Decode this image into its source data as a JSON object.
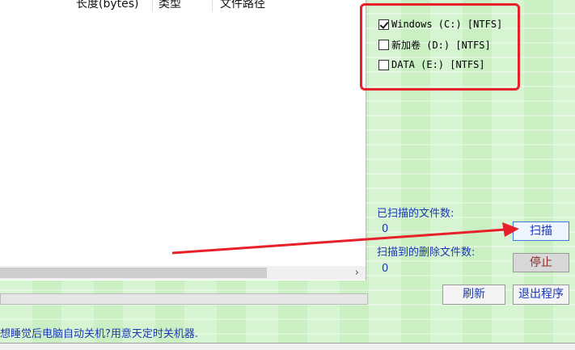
{
  "list": {
    "columns": [
      "长度(bytes)",
      "类型",
      "文件路径"
    ]
  },
  "drives": [
    {
      "label": "Windows (C:) [NTFS]",
      "checked": true
    },
    {
      "label": "新加卷 (D:) [NTFS]",
      "checked": false
    },
    {
      "label": "DATA (E:) [NTFS]",
      "checked": false
    }
  ],
  "stats": {
    "scanned_label": "已扫描的文件数:",
    "scanned_value": "0",
    "deleted_label": "扫描到的删除文件数:",
    "deleted_value": "0"
  },
  "buttons": {
    "scan": "扫描",
    "stop": "停止",
    "refresh": "刷新",
    "exit": "退出程序"
  },
  "tip": "想睡觉后电脑自动关机?用意天定时关机器.",
  "scroll_right_arrow": "›",
  "colors": {
    "annotation_red": "#e8202a",
    "text_blue": "#1a37b6",
    "background_green": "#c9efc3"
  }
}
